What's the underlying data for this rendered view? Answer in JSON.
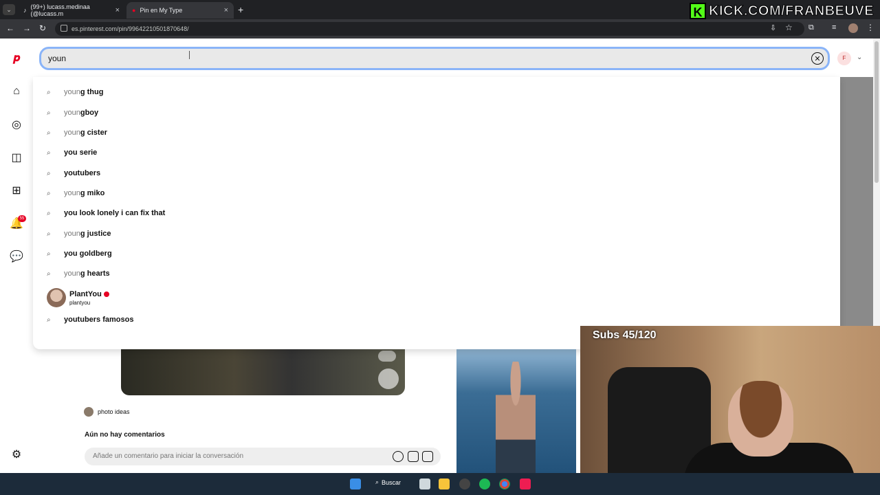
{
  "browser": {
    "tabs": [
      {
        "label": "(99+) lucass.medinaa (@lucass.m"
      },
      {
        "label": "Pin en My Type"
      }
    ],
    "new_tab": "+",
    "url": "es.pinterest.com/pin/99642210501870648/"
  },
  "search": {
    "value": "youn",
    "clear_glyph": "✕"
  },
  "account": {
    "initial": "F"
  },
  "notifications": {
    "badge": "55"
  },
  "suggestions": [
    {
      "prefix": "youn",
      "rest": "g thug"
    },
    {
      "prefix": "youn",
      "rest": "gboy"
    },
    {
      "prefix": "youn",
      "rest": "g cister"
    },
    {
      "prefix": "",
      "rest": "you serie"
    },
    {
      "prefix": "",
      "rest": "youtubers"
    },
    {
      "prefix": "youn",
      "rest": "g miko"
    },
    {
      "prefix": "",
      "rest": "you look lonely i can fix that"
    },
    {
      "prefix": "youn",
      "rest": "g justice"
    },
    {
      "prefix": "",
      "rest": "you goldberg"
    },
    {
      "prefix": "youn",
      "rest": "g hearts"
    }
  ],
  "profile_suggestion": {
    "name": "PlantYou",
    "handle": "plantyou"
  },
  "last_suggestion": {
    "prefix": "",
    "rest": "youtubers famosos"
  },
  "pin": {
    "board": "photo ideas",
    "comments_title": "Aún no hay comentarios",
    "comment_placeholder": "Añade un comentario para iniciar la conversación"
  },
  "stream": {
    "subs": "Subs 45/120",
    "kick_logo": "K",
    "kick_url": "KICK.COM/FRANBEUVE"
  },
  "taskbar": {
    "search_label": "Buscar"
  },
  "colors": {
    "pinterest_red": "#e60023",
    "kick_green": "#53fc18",
    "focus_ring": "#8ab4f8"
  }
}
